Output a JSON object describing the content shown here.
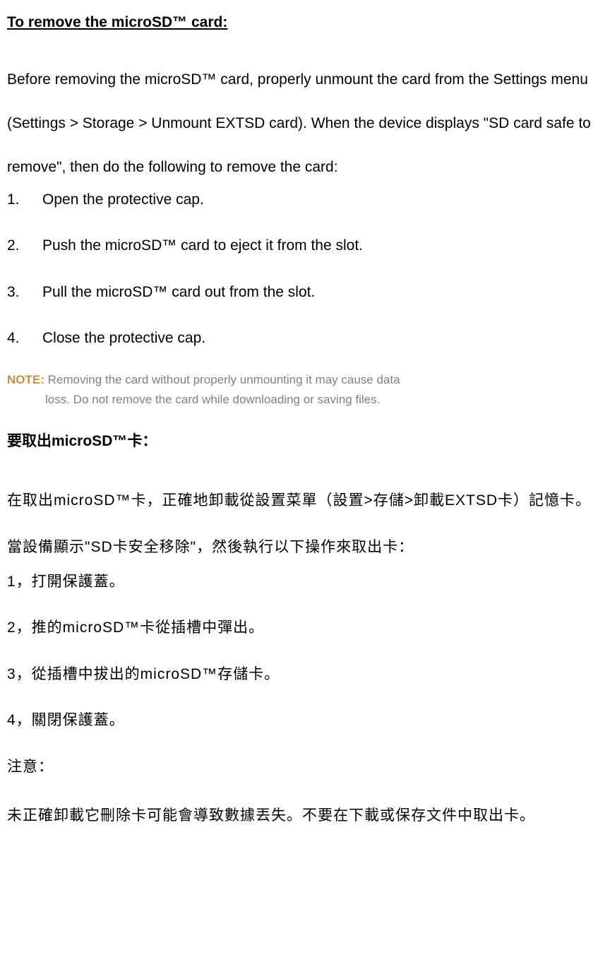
{
  "en": {
    "heading": "To remove the microSD™ card:",
    "intro": "Before removing the microSD™ card, properly unmount the card from the Settings menu (Settings > Storage > Unmount EXTSD card). When the device displays \"SD card safe to remove\", then do the following to remove the card:",
    "steps": [
      {
        "num": "1.",
        "text": "Open the protective cap."
      },
      {
        "num": "2.",
        "text": "Push the microSD™ card to eject it from the slot."
      },
      {
        "num": "3.",
        "text": "Pull the microSD™ card out from the slot."
      },
      {
        "num": "4.",
        "text": "Close the protective cap."
      }
    ],
    "note_label": "NOTE: ",
    "note_line1": "Removing the card without properly unmounting it may cause data",
    "note_line2": "loss. Do not remove the card while downloading or saving files."
  },
  "zh": {
    "heading": "要取出microSD™卡：",
    "intro": "在取出microSD™卡，正確地卸載從設置菜單（設置>存儲>卸載EXTSD卡）記憶卡。當設備顯示\"SD卡安全移除\"，然後執行以下操作來取出卡：",
    "steps": [
      "1，打開保護蓋。",
      "2，推的microSD™卡從插槽中彈出。",
      "3，從插槽中拔出的microSD™存儲卡。",
      "4，關閉保護蓋。"
    ],
    "note_label": "注意：",
    "note_body": "未正確卸載它刪除卡可能會導致數據丟失。不要在下載或保存文件中取出卡。"
  }
}
